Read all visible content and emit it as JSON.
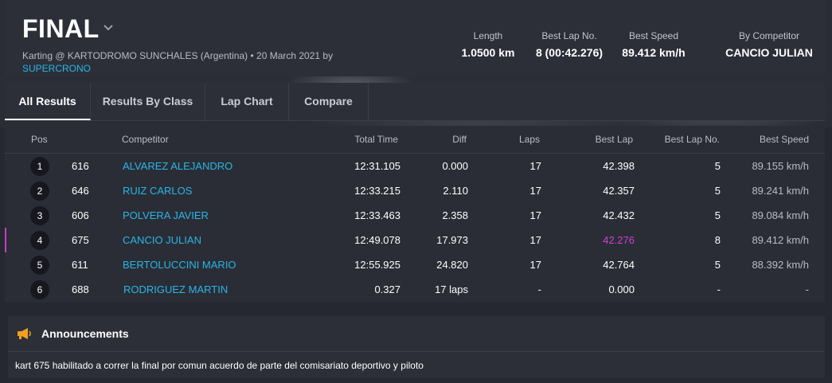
{
  "header": {
    "title": "FINAL",
    "subtitle": "Karting @ KARTODROMO SUNCHALES (Argentina) • 20 March 2021 by",
    "subtitle_link": "SUPERCRONO",
    "stats": [
      {
        "label": "Length",
        "value": "1.0500 km"
      },
      {
        "label": "Best Lap No.",
        "value": "8 (00:42.276)"
      },
      {
        "label": "Best Speed",
        "value": "89.412 km/h"
      },
      {
        "label": "By Competitor",
        "value": "CANCIO JULIAN"
      }
    ]
  },
  "tabs": [
    {
      "label": "All Results",
      "active": true
    },
    {
      "label": "Results By Class",
      "active": false
    },
    {
      "label": "Lap Chart",
      "active": false
    },
    {
      "label": "Compare",
      "active": false
    }
  ],
  "table": {
    "headers": {
      "pos": "Pos",
      "competitor": "Competitor",
      "total_time": "Total Time",
      "diff": "Diff",
      "laps": "Laps",
      "best_lap": "Best Lap",
      "best_lap_no": "Best Lap No.",
      "best_speed": "Best Speed"
    },
    "rows": [
      {
        "pos": "1",
        "num": "616",
        "name": "ALVAREZ ALEJANDRO",
        "total": "12:31.105",
        "diff": "0.000",
        "laps": "17",
        "best": "42.398",
        "best_no": "5",
        "speed": "89.155 km/h"
      },
      {
        "pos": "2",
        "num": "646",
        "name": "RUIZ CARLOS",
        "total": "12:33.215",
        "diff": "2.110",
        "laps": "17",
        "best": "42.357",
        "best_no": "5",
        "speed": "89.241 km/h"
      },
      {
        "pos": "3",
        "num": "606",
        "name": "POLVERA JAVIER",
        "total": "12:33.463",
        "diff": "2.358",
        "laps": "17",
        "best": "42.432",
        "best_no": "5",
        "speed": "89.084 km/h"
      },
      {
        "pos": "4",
        "num": "675",
        "name": "CANCIO JULIAN",
        "total": "12:49.078",
        "diff": "17.973",
        "laps": "17",
        "best": "42.276",
        "best_no": "8",
        "speed": "89.412 km/h"
      },
      {
        "pos": "5",
        "num": "611",
        "name": "BERTOLUCCINI MARIO",
        "total": "12:55.925",
        "diff": "24.820",
        "laps": "17",
        "best": "42.764",
        "best_no": "5",
        "speed": "88.392 km/h"
      },
      {
        "pos": "6",
        "num": "688",
        "name": "RODRIGUEZ MARTIN",
        "total": "0.327",
        "diff": "17 laps",
        "laps": "-",
        "best": "0.000",
        "best_no": "-",
        "speed": "-"
      }
    ]
  },
  "announcements": {
    "title": "Announcements",
    "icon": "megaphone-icon",
    "text": "kart 675 habilitado a correr la final por comun acuerdo de parte del comisariato deportivo y piloto"
  },
  "colors": {
    "link": "#29b6e8",
    "best_lap_highlight": "#d040d0",
    "announcement_icon": "#f0a020"
  }
}
